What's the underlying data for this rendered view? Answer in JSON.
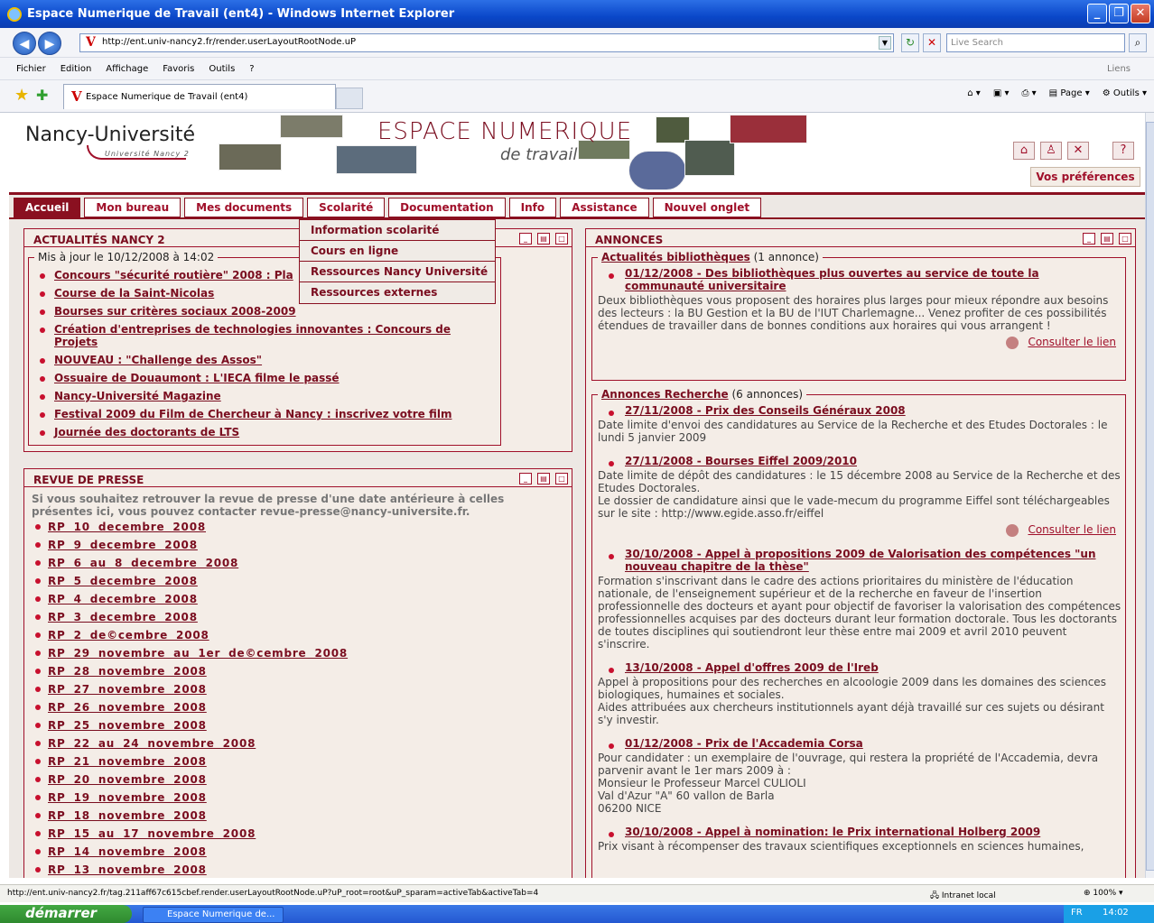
{
  "window": {
    "title": "Espace Numerique de Travail (ent4) - Windows Internet Explorer"
  },
  "browser": {
    "url": "http://ent.univ-nancy2.fr/render.userLayoutRootNode.uP",
    "search_placeholder": "Live Search",
    "menu": [
      "Fichier",
      "Edition",
      "Affichage",
      "Favoris",
      "Outils",
      "?"
    ],
    "links_label": "Liens",
    "tab_title": "Espace Numerique de Travail (ent4)",
    "page_label": "Page",
    "tools_label": "Outils"
  },
  "header": {
    "logo": "Nancy-Université",
    "logo_sub": "Université Nancy 2",
    "title": "ESPACE NUMERIQUE",
    "subtitle": "de travail",
    "prefs": "Vos préférences"
  },
  "nav_tabs": [
    "Accueil",
    "Mon bureau",
    "Mes documents",
    "Scolarité",
    "Documentation",
    "Info",
    "Assistance",
    "Nouvel onglet"
  ],
  "dropdown": [
    "Information scolarité",
    "Cours en ligne",
    "Ressources Nancy Université",
    "Ressources externes"
  ],
  "actualites": {
    "title": "ACTUALITÉS NANCY 2",
    "legend": "Mis à jour le 10/12/2008 à 14:02",
    "items": [
      "Concours \"sécurité routière\" 2008 : Pla",
      "Course de la Saint-Nicolas",
      "Bourses sur critères sociaux 2008-2009",
      "Création d'entreprises de technologies innovantes : Concours de Projets",
      "NOUVEAU : \"Challenge des Assos\"",
      "Ossuaire de Douaumont : L'IECA filme le passé",
      "Nancy-Université Magazine",
      "Festival 2009 du Film de Chercheur à Nancy : inscrivez votre film",
      "Journée des doctorants de LTS"
    ]
  },
  "revue": {
    "title": "REVUE DE PRESSE",
    "intro": "Si vous souhaitez retrouver la revue de presse d'une date antérieure à celles présentes ici, vous pouvez contacter revue-presse@nancy-universite.fr.",
    "items": [
      "RP 10 decembre 2008",
      "RP 9 decembre 2008",
      "RP 6 au 8 decembre 2008",
      "RP 5 decembre 2008",
      "RP 4 decembre 2008",
      "RP 3 decembre 2008",
      "RP 2 de©cembre 2008",
      "RP 29 novembre au 1er de©cembre 2008",
      "RP 28 novembre 2008",
      "RP 27 novembre 2008",
      "RP 26 novembre 2008",
      "RP 25 novembre 2008",
      "RP 22 au 24 novembre 2008",
      "RP 21 novembre 2008",
      "RP 20 novembre 2008",
      "RP 19 novembre 2008",
      "RP 18 novembre 2008",
      "RP 15 au 17 novembre 2008",
      "RP 14 novembre 2008",
      "RP 13 novembre 2008"
    ]
  },
  "annonces": {
    "title": "ANNONCES",
    "consult": "Consulter le lien",
    "biblio": {
      "legend_link": "Actualités bibliothèques",
      "legend_count": "(1 annonce)",
      "items": [
        {
          "title": "01/12/2008 - Des bibliothèques plus ouvertes au service de toute la communauté universitaire",
          "body": "Deux bibliothèques vous proposent des horaires plus larges pour mieux répondre aux besoins des lecteurs : la BU Gestion et la BU de l'IUT Charlemagne... Venez profiter de ces possibilités étendues de travailler dans de bonnes conditions aux horaires qui vous arrangent !"
        }
      ]
    },
    "recherche": {
      "legend_link": "Annonces Recherche",
      "legend_count": "(6 annonces)",
      "items": [
        {
          "title": "27/11/2008 - Prix des Conseils Généraux 2008",
          "body": "Date limite d'envoi des candidatures au Service de la Recherche et des Etudes Doctorales : le lundi 5 janvier 2009"
        },
        {
          "title": "27/11/2008 - Bourses Eiffel 2009/2010",
          "body": "Date limite de dépôt des candidatures : le 15 décembre 2008 au Service de la Recherche et des Etudes Doctorales.\nLe dossier de candidature ainsi que le vade-mecum du programme Eiffel sont téléchargeables sur le site : http://www.egide.asso.fr/eiffel"
        },
        {
          "title": "30/10/2008 - Appel à propositions 2009 de Valorisation des compétences \"un nouveau chapitre de la thèse\"",
          "body": "Formation s'inscrivant dans le cadre des actions prioritaires du ministère de l'éducation nationale, de l'enseignement supérieur et de la recherche en faveur de l'insertion professionnelle des docteurs et ayant pour objectif de favoriser la valorisation des compétences professionnelles acquises par des docteurs durant leur formation doctorale. Tous les doctorants de toutes disciplines qui soutiendront leur thèse entre mai 2009 et avril 2010 peuvent s'inscrire."
        },
        {
          "title": "13/10/2008 - Appel d'offres 2009 de l'Ireb",
          "body": "Appel à propositions pour des recherches en alcoologie 2009 dans les domaines des sciences biologiques, humaines et sociales.\nAides attribuées aux chercheurs institutionnels ayant déjà travaillé sur ces sujets ou désirant s'y investir."
        },
        {
          "title": "01/12/2008 - Prix de l'Accademia Corsa",
          "body": "Pour candidater : un exemplaire de l'ouvrage, qui restera la propriété de l'Accademia, devra parvenir avant le 1er mars 2009 à :\nMonsieur le Professeur Marcel CULIOLI\nVal d'Azur \"A\" 60 vallon de Barla\n06200 NICE"
        },
        {
          "title": "30/10/2008 - Appel à nomination: le Prix international Holberg 2009",
          "body": "Prix visant à récompenser des travaux scientifiques exceptionnels en sciences humaines,"
        }
      ]
    }
  },
  "status": {
    "url": "http://ent.univ-nancy2.fr/tag.211aff67c615cbef.render.userLayoutRootNode.uP?uP_root=root&uP_sparam=activeTab&activeTab=4",
    "zone": "Intranet local",
    "zoom": "100%"
  },
  "taskbar": {
    "start": "démarrer",
    "item": "Espace Numerique de...",
    "lang": "FR",
    "time": "14:02"
  }
}
